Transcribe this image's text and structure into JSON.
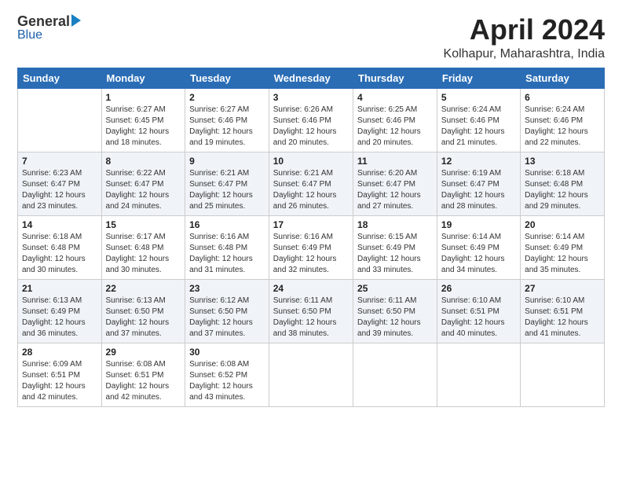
{
  "logo": {
    "general": "General",
    "blue": "Blue",
    "tagline": ""
  },
  "header": {
    "title": "April 2024",
    "subtitle": "Kolhapur, Maharashtra, India"
  },
  "columns": [
    "Sunday",
    "Monday",
    "Tuesday",
    "Wednesday",
    "Thursday",
    "Friday",
    "Saturday"
  ],
  "weeks": [
    [
      {
        "num": "",
        "info": ""
      },
      {
        "num": "1",
        "info": "Sunrise: 6:27 AM\nSunset: 6:45 PM\nDaylight: 12 hours\nand 18 minutes."
      },
      {
        "num": "2",
        "info": "Sunrise: 6:27 AM\nSunset: 6:46 PM\nDaylight: 12 hours\nand 19 minutes."
      },
      {
        "num": "3",
        "info": "Sunrise: 6:26 AM\nSunset: 6:46 PM\nDaylight: 12 hours\nand 20 minutes."
      },
      {
        "num": "4",
        "info": "Sunrise: 6:25 AM\nSunset: 6:46 PM\nDaylight: 12 hours\nand 20 minutes."
      },
      {
        "num": "5",
        "info": "Sunrise: 6:24 AM\nSunset: 6:46 PM\nDaylight: 12 hours\nand 21 minutes."
      },
      {
        "num": "6",
        "info": "Sunrise: 6:24 AM\nSunset: 6:46 PM\nDaylight: 12 hours\nand 22 minutes."
      }
    ],
    [
      {
        "num": "7",
        "info": "Sunrise: 6:23 AM\nSunset: 6:47 PM\nDaylight: 12 hours\nand 23 minutes."
      },
      {
        "num": "8",
        "info": "Sunrise: 6:22 AM\nSunset: 6:47 PM\nDaylight: 12 hours\nand 24 minutes."
      },
      {
        "num": "9",
        "info": "Sunrise: 6:21 AM\nSunset: 6:47 PM\nDaylight: 12 hours\nand 25 minutes."
      },
      {
        "num": "10",
        "info": "Sunrise: 6:21 AM\nSunset: 6:47 PM\nDaylight: 12 hours\nand 26 minutes."
      },
      {
        "num": "11",
        "info": "Sunrise: 6:20 AM\nSunset: 6:47 PM\nDaylight: 12 hours\nand 27 minutes."
      },
      {
        "num": "12",
        "info": "Sunrise: 6:19 AM\nSunset: 6:47 PM\nDaylight: 12 hours\nand 28 minutes."
      },
      {
        "num": "13",
        "info": "Sunrise: 6:18 AM\nSunset: 6:48 PM\nDaylight: 12 hours\nand 29 minutes."
      }
    ],
    [
      {
        "num": "14",
        "info": "Sunrise: 6:18 AM\nSunset: 6:48 PM\nDaylight: 12 hours\nand 30 minutes."
      },
      {
        "num": "15",
        "info": "Sunrise: 6:17 AM\nSunset: 6:48 PM\nDaylight: 12 hours\nand 30 minutes."
      },
      {
        "num": "16",
        "info": "Sunrise: 6:16 AM\nSunset: 6:48 PM\nDaylight: 12 hours\nand 31 minutes."
      },
      {
        "num": "17",
        "info": "Sunrise: 6:16 AM\nSunset: 6:49 PM\nDaylight: 12 hours\nand 32 minutes."
      },
      {
        "num": "18",
        "info": "Sunrise: 6:15 AM\nSunset: 6:49 PM\nDaylight: 12 hours\nand 33 minutes."
      },
      {
        "num": "19",
        "info": "Sunrise: 6:14 AM\nSunset: 6:49 PM\nDaylight: 12 hours\nand 34 minutes."
      },
      {
        "num": "20",
        "info": "Sunrise: 6:14 AM\nSunset: 6:49 PM\nDaylight: 12 hours\nand 35 minutes."
      }
    ],
    [
      {
        "num": "21",
        "info": "Sunrise: 6:13 AM\nSunset: 6:49 PM\nDaylight: 12 hours\nand 36 minutes."
      },
      {
        "num": "22",
        "info": "Sunrise: 6:13 AM\nSunset: 6:50 PM\nDaylight: 12 hours\nand 37 minutes."
      },
      {
        "num": "23",
        "info": "Sunrise: 6:12 AM\nSunset: 6:50 PM\nDaylight: 12 hours\nand 37 minutes."
      },
      {
        "num": "24",
        "info": "Sunrise: 6:11 AM\nSunset: 6:50 PM\nDaylight: 12 hours\nand 38 minutes."
      },
      {
        "num": "25",
        "info": "Sunrise: 6:11 AM\nSunset: 6:50 PM\nDaylight: 12 hours\nand 39 minutes."
      },
      {
        "num": "26",
        "info": "Sunrise: 6:10 AM\nSunset: 6:51 PM\nDaylight: 12 hours\nand 40 minutes."
      },
      {
        "num": "27",
        "info": "Sunrise: 6:10 AM\nSunset: 6:51 PM\nDaylight: 12 hours\nand 41 minutes."
      }
    ],
    [
      {
        "num": "28",
        "info": "Sunrise: 6:09 AM\nSunset: 6:51 PM\nDaylight: 12 hours\nand 42 minutes."
      },
      {
        "num": "29",
        "info": "Sunrise: 6:08 AM\nSunset: 6:51 PM\nDaylight: 12 hours\nand 42 minutes."
      },
      {
        "num": "30",
        "info": "Sunrise: 6:08 AM\nSunset: 6:52 PM\nDaylight: 12 hours\nand 43 minutes."
      },
      {
        "num": "",
        "info": ""
      },
      {
        "num": "",
        "info": ""
      },
      {
        "num": "",
        "info": ""
      },
      {
        "num": "",
        "info": ""
      }
    ]
  ]
}
